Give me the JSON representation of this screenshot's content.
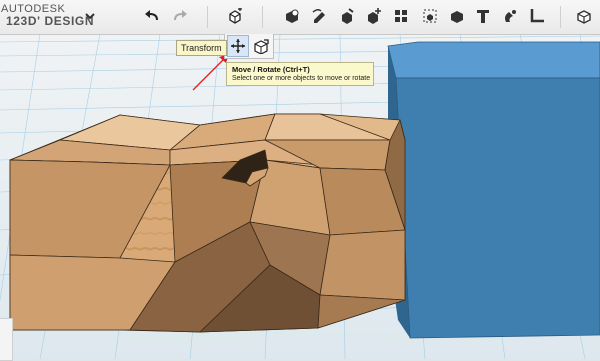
{
  "app": {
    "brand_line1": "AUTODESK",
    "brand_line2": "123D' DESIGN"
  },
  "toolbar": {
    "menu_chevron_icon": "chevron-down-icon",
    "undo_icon": "undo-icon",
    "redo_icon": "redo-icon",
    "transform_icon": "transform-icon"
  },
  "transform_popup": {
    "chip_label": "Transform"
  },
  "tooltip": {
    "title": "Move / Rotate (Ctrl+T)",
    "description": "Select one or more objects to move or rotate"
  },
  "colors": {
    "wood_light": "#d9aa78",
    "wood_dark": "#a98158",
    "blue_box": "#3f7fb0",
    "grid_line": "#8ec4e3"
  }
}
